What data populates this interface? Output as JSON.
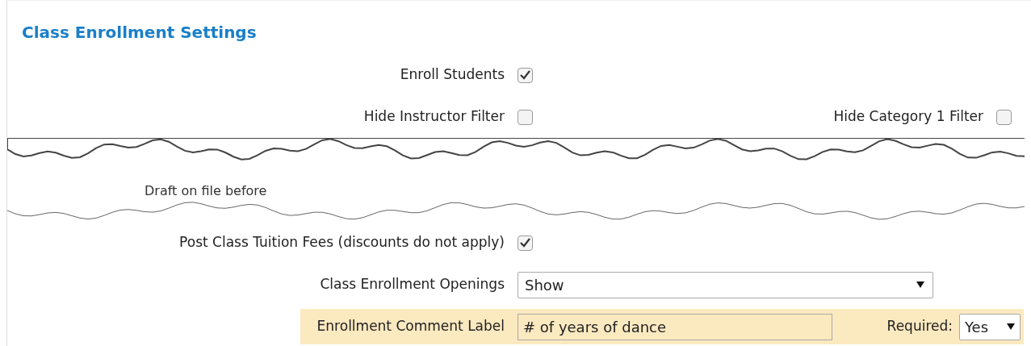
{
  "title": "Class Enrollment Settings",
  "rows": [
    {
      "kind": "checkbox",
      "label": "Enroll Students",
      "checked": true
    },
    {
      "kind": "checkbox",
      "label": "Hide Instructor Filter",
      "checked": false,
      "extra": {
        "label": "Hide Category 1 Filter",
        "checked": false
      }
    },
    {
      "kind": "tear",
      "fragment": "Draft on file before"
    },
    {
      "kind": "checkbox",
      "label": "Post Class Tuition Fees (discounts do not apply)",
      "checked": true
    },
    {
      "kind": "select",
      "label": "Class Enrollment Openings",
      "value": "Show"
    },
    {
      "kind": "text",
      "label": "Enrollment Comment Label",
      "value": "# of years of dance",
      "highlighted": true,
      "required": {
        "label": "Required:",
        "value": "Yes"
      }
    }
  ]
}
